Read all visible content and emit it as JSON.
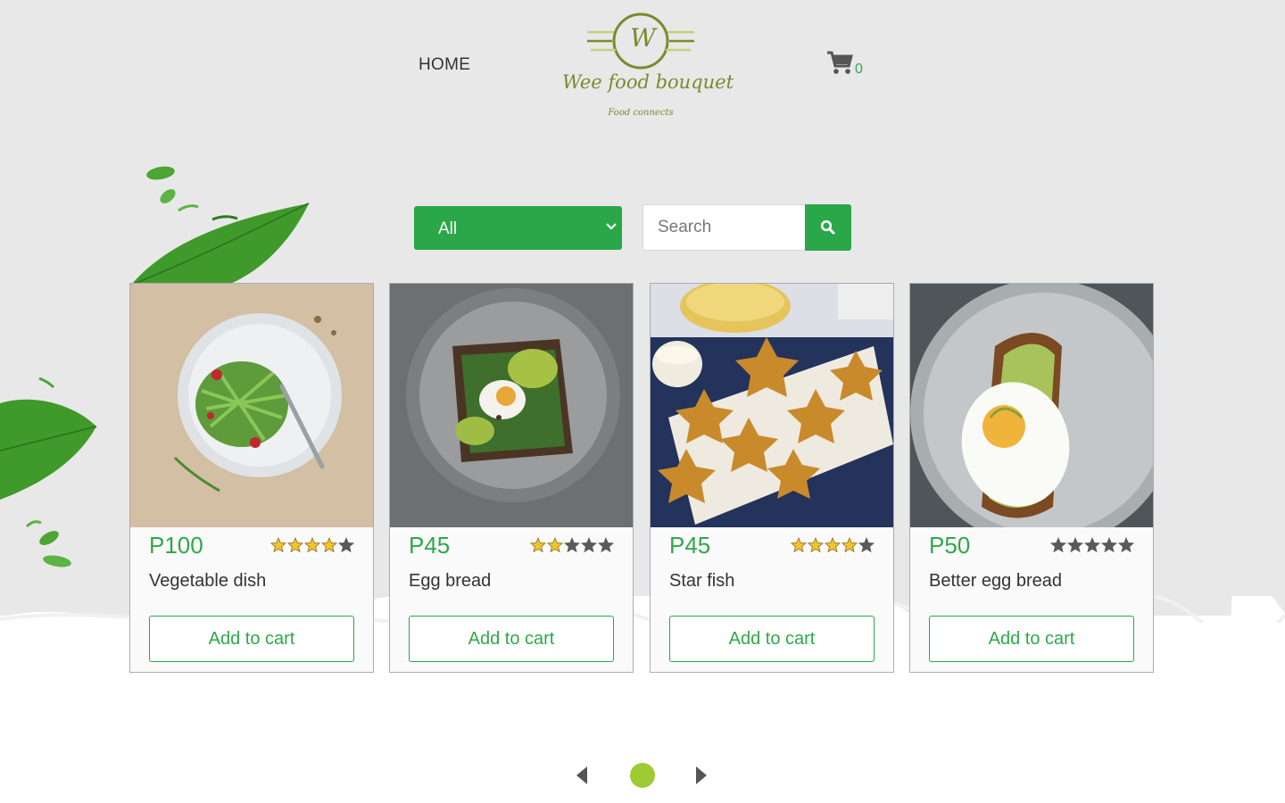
{
  "nav": {
    "home_label": "HOME"
  },
  "logo": {
    "letter": "W",
    "name": "Wee food bouquet",
    "tagline": "Food connects"
  },
  "cart": {
    "count": "0",
    "icon": "cart-icon"
  },
  "filter": {
    "category_selected": "All",
    "search_placeholder": "Search",
    "search_icon": "search-icon"
  },
  "colors": {
    "accent": "#2aa748",
    "price": "#2fa84a",
    "pager_dot": "#9ccb34",
    "background": "#e8e8e8"
  },
  "products": [
    {
      "price": "P100",
      "name": "Vegetable dish",
      "rating": 4,
      "button": "Add to cart"
    },
    {
      "price": "P45",
      "name": "Egg bread",
      "rating": 2,
      "button": "Add to cart"
    },
    {
      "price": "P45",
      "name": "Star fish",
      "rating": 4,
      "button": "Add to cart"
    },
    {
      "price": "P50",
      "name": "Better egg bread",
      "rating": 0,
      "button": "Add to cart"
    }
  ],
  "pagination": {
    "current_page": 1,
    "total_pages": 1
  }
}
